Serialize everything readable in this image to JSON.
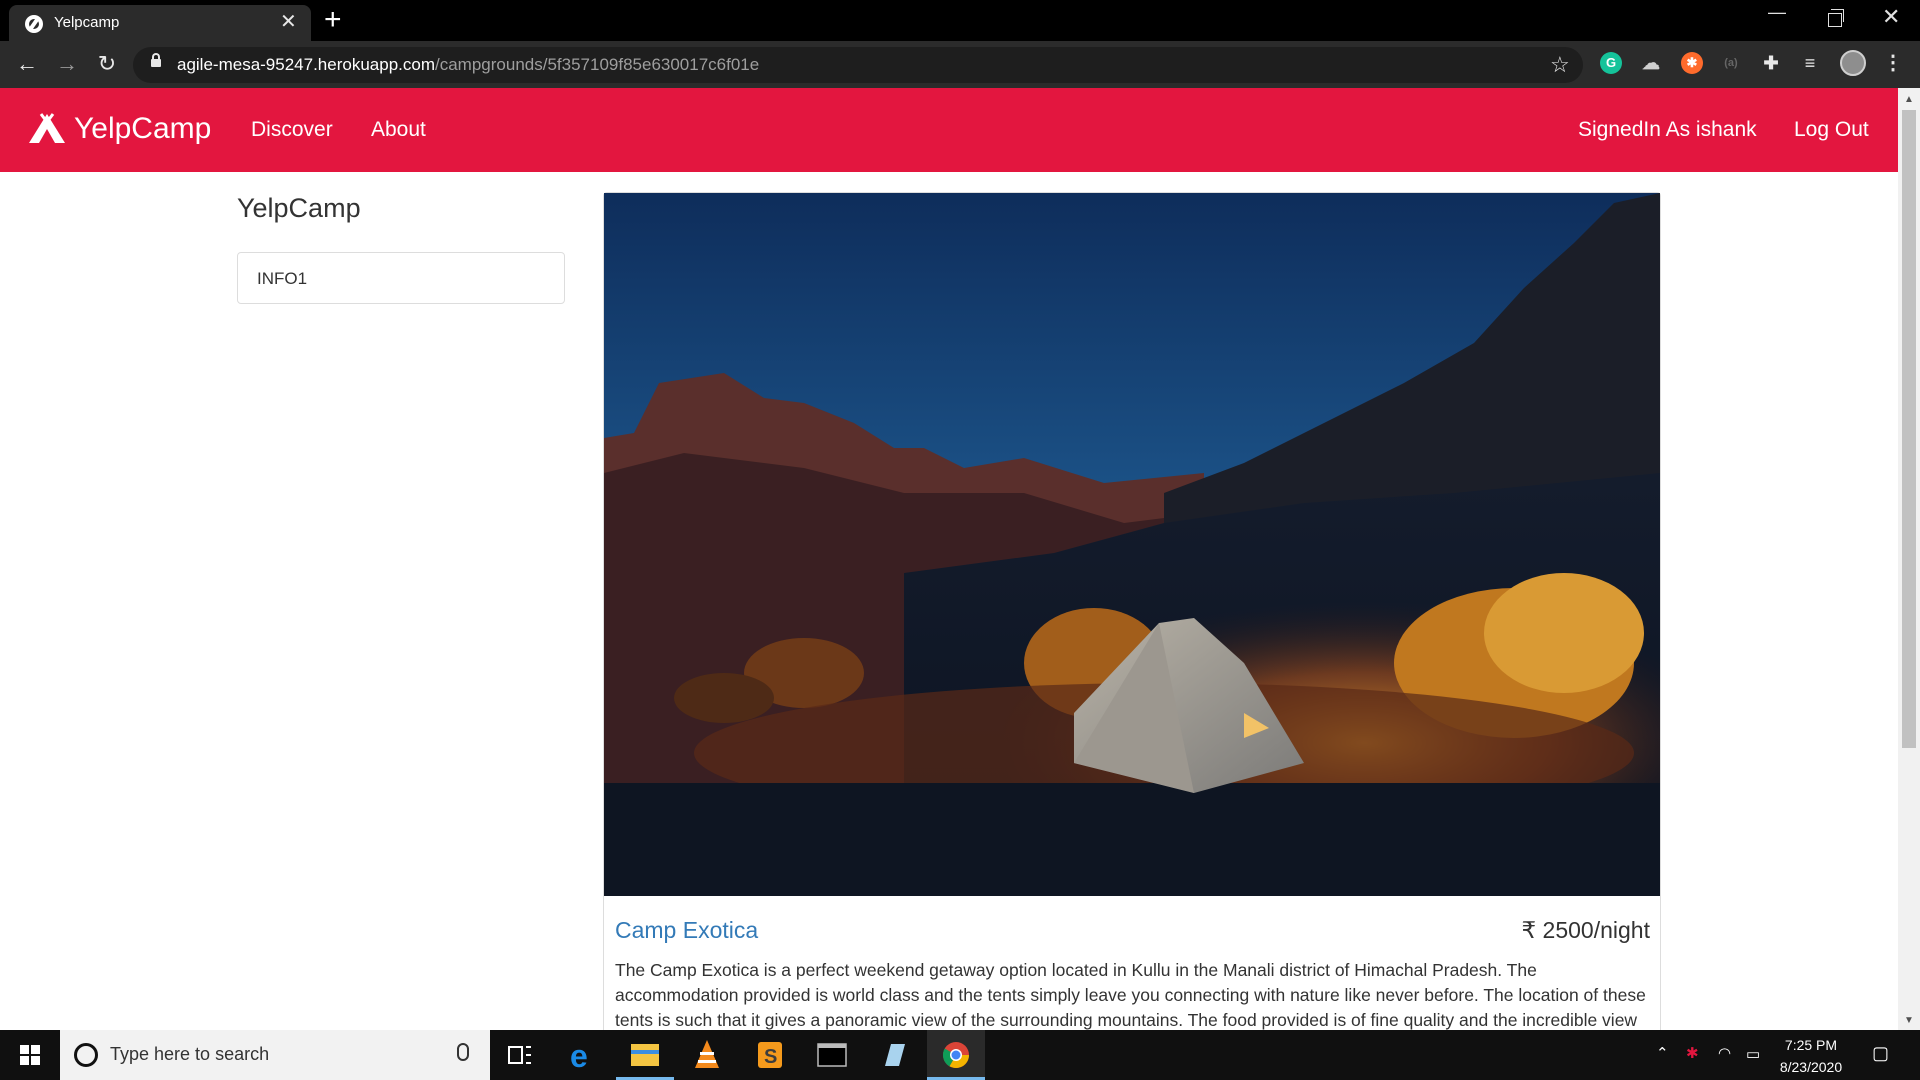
{
  "browser": {
    "tab_title": "Yelpcamp",
    "new_tab_label": "+",
    "close_tab_label": "✕",
    "url_host": "agile-mesa-95247.herokuapp.com",
    "url_path": "/campgrounds/5f357109f85e630017c6f01e"
  },
  "navbar": {
    "brand": "YelpCamp",
    "links": [
      "Discover",
      "About"
    ],
    "signed_in": "SignedIn As ishank",
    "logout": "Log Out",
    "color": "#e3163f"
  },
  "sidebar": {
    "title": "YelpCamp",
    "items": [
      "INFO1"
    ]
  },
  "campground": {
    "name": "Camp Exotica",
    "price": "₹ 2500/night",
    "description": "The Camp Exotica is a perfect weekend getaway option located in Kullu in the Manali district of Himachal Pradesh. The accommodation provided is world class and the tents simply leave you connecting with nature like never before. The location of these tents is such that it gives a panoramic view of the surrounding mountains. The food provided is of fine quality and the incredible view"
  },
  "taskbar": {
    "search_placeholder": "Type here to search",
    "time": "7:25 PM",
    "date": "8/23/2020"
  }
}
